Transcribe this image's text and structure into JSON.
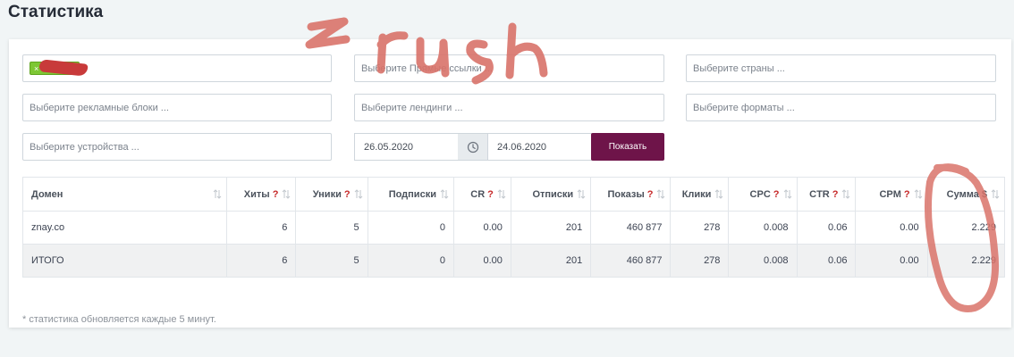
{
  "page": {
    "title": "Статистика"
  },
  "filters": {
    "site_tag": "",
    "direct_links_placeholder": "Выберите Прямые ссылки ...",
    "countries_placeholder": "Выберите страны ...",
    "ad_blocks_placeholder": "Выберите рекламные блоки ...",
    "landings_placeholder": "Выберите лендинги ...",
    "formats_placeholder": "Выберите форматы ...",
    "devices_placeholder": "Выберите устройства ...",
    "date_from": "26.05.2020",
    "date_to": "24.06.2020",
    "show_label": "Показать"
  },
  "table": {
    "columns": [
      {
        "label": "Домен",
        "help": ""
      },
      {
        "label": "Хиты",
        "help": "?"
      },
      {
        "label": "Уники",
        "help": "?"
      },
      {
        "label": "Подписки",
        "help": ""
      },
      {
        "label": "CR",
        "help": "?"
      },
      {
        "label": "Отписки",
        "help": ""
      },
      {
        "label": "Показы",
        "help": "?"
      },
      {
        "label": "Клики",
        "help": ""
      },
      {
        "label": "CPC",
        "help": "?"
      },
      {
        "label": "CTR",
        "help": "?"
      },
      {
        "label": "CPM",
        "help": "?"
      },
      {
        "label": "Сумма $",
        "help": ""
      }
    ],
    "rows": [
      {
        "cells": [
          "znay.co",
          "6",
          "5",
          "0",
          "0.00",
          "201",
          "460 877",
          "278",
          "0.008",
          "0.06",
          "0.00",
          "2.229"
        ]
      }
    ],
    "total": {
      "cells": [
        "ИТОГО",
        "6",
        "5",
        "0",
        "0.00",
        "201",
        "460 877",
        "278",
        "0.008",
        "0.06",
        "0.00",
        "2.229"
      ]
    }
  },
  "footer": {
    "note": "* статистика обновляется каждые 5 минут."
  },
  "annotation": {
    "text": "zrush"
  },
  "colors": {
    "accent_button": "#6e1449",
    "tag_green": "#7dc734",
    "help_mark": "#c62828",
    "marker_red": "#d9736a"
  },
  "icons": {
    "sort": "sort-arrows-icon",
    "clock": "clock-icon"
  }
}
